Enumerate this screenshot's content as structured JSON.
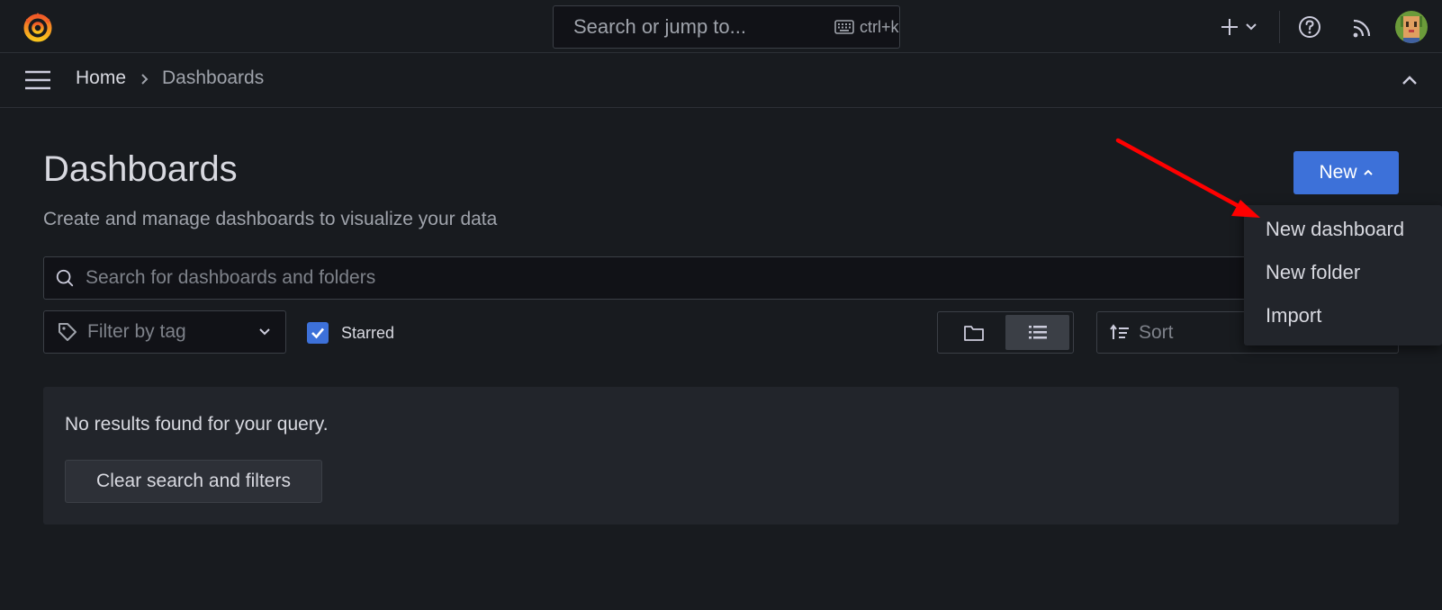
{
  "topbar": {
    "search_placeholder": "Search or jump to...",
    "shortcut_hint": "ctrl+k"
  },
  "breadcrumb": {
    "home": "Home",
    "separator": "›",
    "current": "Dashboards"
  },
  "page": {
    "title": "Dashboards",
    "subtitle": "Create and manage dashboards to visualize your data",
    "new_button_label": "New"
  },
  "new_menu": {
    "items": [
      "New dashboard",
      "New folder",
      "Import"
    ]
  },
  "filters": {
    "search_placeholder": "Search for dashboards and folders",
    "tag_placeholder": "Filter by tag",
    "starred_label": "Starred",
    "starred_checked": true,
    "view_mode": "list",
    "sort_placeholder": "Sort"
  },
  "empty_state": {
    "message": "No results found for your query.",
    "clear_button_label": "Clear search and filters"
  },
  "colors": {
    "background": "#181b1f",
    "primary": "#3d71d9",
    "panel": "#22252b",
    "annotation_arrow": "#ff0000"
  },
  "icons": {
    "logo": "grafana-logo",
    "search": "search-icon",
    "keyboard": "keyboard-icon",
    "add": "plus-icon",
    "help": "help-icon",
    "news": "rss-icon",
    "menu": "hamburger-icon",
    "collapse": "chevron-up-icon",
    "tag": "tag-icon",
    "folder_view": "folder-icon",
    "list_view": "list-icon",
    "sort": "sort-icon"
  }
}
